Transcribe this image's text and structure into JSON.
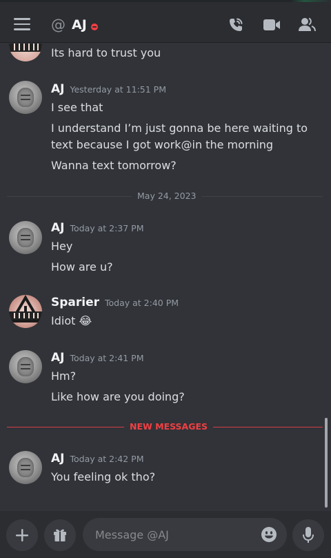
{
  "header": {
    "at_symbol": "@",
    "title": "AJ",
    "status": "do-not-disturb"
  },
  "icons": {
    "menu": "hamburger-menu-icon",
    "call": "phone-call-icon",
    "video": "video-camera-icon",
    "members": "member-list-icon",
    "add": "plus-icon",
    "gift": "gift-icon",
    "emoji": "smiley-face-icon",
    "mic": "microphone-icon"
  },
  "messages": [
    {
      "text": "Its hard to trust you"
    },
    {
      "author": "AJ",
      "timestamp": "Yesterday at 11:51 PM",
      "lines": [
        "I see that",
        "I understand I’m just gonna be here waiting to text because I got work@in the morning",
        "Wanna text tomorrow?"
      ]
    },
    {
      "author": "AJ",
      "timestamp": "Today at 2:37 PM",
      "lines": [
        "Hey",
        "How are u?"
      ]
    },
    {
      "author": "Sparier",
      "timestamp": "Today at 2:40 PM",
      "lines": [
        "Idiot"
      ],
      "emoji": "😂"
    },
    {
      "author": "AJ",
      "timestamp": "Today at 2:41 PM",
      "lines": [
        "Hm?",
        "Like how are you doing?"
      ]
    },
    {
      "author": "AJ",
      "timestamp": "Today at 2:42 PM",
      "lines": [
        "You feeling ok tho?"
      ]
    }
  ],
  "date_divider": "May 24, 2023",
  "new_messages_label": "NEW MESSAGES",
  "composer": {
    "placeholder": "Message @AJ"
  },
  "colors": {
    "background": "#313338",
    "header": "#2b2d31",
    "new_messages": "#f23f43",
    "dnd_status": "#f23f43"
  }
}
